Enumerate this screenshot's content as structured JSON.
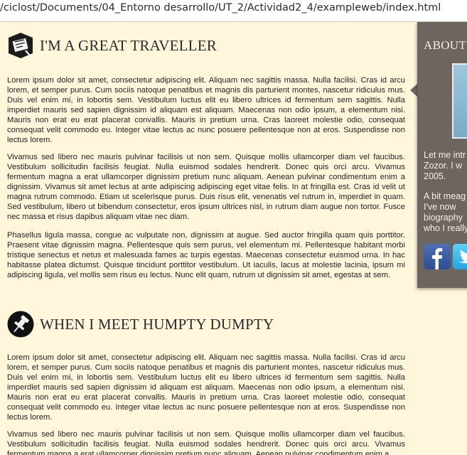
{
  "browser": {
    "url": "/ciclost/Documents/04_Entorno desarrollo/UT_2/Actividad2_4/exampleweb/index.html"
  },
  "posts": [
    {
      "title": "I'M A GREAT TRAVELLER",
      "icon": "pin-note-icon",
      "paragraphs": [
        "Lorem ipsum dolor sit amet, consectetur adipiscing elit. Aliquam nec sagittis massa. Nulla facilisi. Cras id arcu lorem, et semper purus. Cum sociis natoque penatibus et magnis dis parturient montes, nascetur ridiculus mus. Duis vel enim mi, in lobortis sem. Vestibulum luctus elit eu libero ultrices id fermentum sem sagittis. Nulla imperdiet mauris sed sapien dignissim id aliquam est aliquam. Maecenas non odio ipsum, a elementum nisi. Mauris non erat eu erat placerat convallis. Mauris in pretium urna. Cras laoreet molestie odio, consequat consequat velit commodo eu. Integer vitae lectus ac nunc posuere pellentesque non at eros. Suspendisse non lectus lorem.",
        "Vivamus sed libero nec mauris pulvinar facilisis ut non sem. Quisque mollis ullamcorper diam vel faucibus. Vestibulum sollicitudin facilisis feugiat. Nulla euismod sodales hendrerit. Donec quis orci arcu. Vivamus fermentum magna a erat ullamcorper dignissim pretium nunc aliquam. Aenean pulvinar condimentum enim a dignissim. Vivamus sit amet lectus at ante adipiscing adipiscing eget vitae felis. In at fringilla est. Cras id velit ut magna rutrum commodo. Etiam ut scelerisque purus. Duis risus elit, venenatis vel rutrum in, imperdiet in quam. Sed vestibulum, libero ut bibendum consectetur, eros ipsum ultrices nisl, in rutrum diam augue non tortor. Fusce nec massa et risus dapibus aliquam vitae nec diam.",
        "Phasellus ligula massa, congue ac vulputate non, dignissim at augue. Sed auctor fringilla quam quis porttitor. Praesent vitae dignissim magna. Pellentesque quis sem purus, vel elementum mi. Pellentesque habitant morbi tristique senectus et netus et malesuada fames ac turpis egestas. Maecenas consectetur euismod urna. In hac habitasse platea dictumst. Quisque tincidunt porttitor vestibulum. Ut iaculis, lacus at molestie lacinia, ipsum mi adipiscing ligula, vel mollis sem risus eu lectus. Nunc elit quam, rutrum ut dignissim sit amet, egestas at sem."
      ]
    },
    {
      "title": "WHEN I MEET HUMPTY DUMPTY",
      "icon": "pushpin-icon",
      "paragraphs": [
        "Lorem ipsum dolor sit amet, consectetur adipiscing elit. Aliquam nec sagittis massa. Nulla facilisi. Cras id arcu lorem, et semper purus. Cum sociis natoque penatibus et magnis dis parturient montes, nascetur ridiculus mus. Duis vel enim mi, in lobortis sem. Vestibulum luctus elit eu libero ultrices id fermentum sem sagittis. Nulla imperdiet mauris sed sapien dignissim id aliquam est aliquam. Maecenas non odio ipsum, a elementum nisi. Mauris non erat eu erat placerat convallis. Mauris in pretium urna. Cras laoreet molestie odio, consequat consequat velit commodo eu. Integer vitae lectus ac nunc posuere pellentesque non at eros. Suspendisse non lectus lorem.",
        "Vivamus sed libero nec mauris pulvinar facilisis ut non sem. Quisque mollis ullamcorper diam vel faucibus. Vestibulum sollicitudin facilisis feugiat. Nulla euismod sodales hendrerit. Donec quis orci arcu. Vivamus fermentum magna a erat ullamcorper dignissim pretium nunc aliquam. Aenean pulvinar condimentum enim a"
      ]
    }
  ],
  "sidebar": {
    "title": "ABOUT",
    "intro_lines": [
      "Let me intr",
      "Zozor. I w",
      "2005."
    ],
    "bio_lines": [
      "A bit meag",
      "I've now",
      "biography",
      "who I really"
    ]
  },
  "colors": {
    "background": "#fff6dc",
    "sidebar": "#6d6660",
    "facebook": "#3b5998",
    "twitter": "#33b9ec"
  }
}
